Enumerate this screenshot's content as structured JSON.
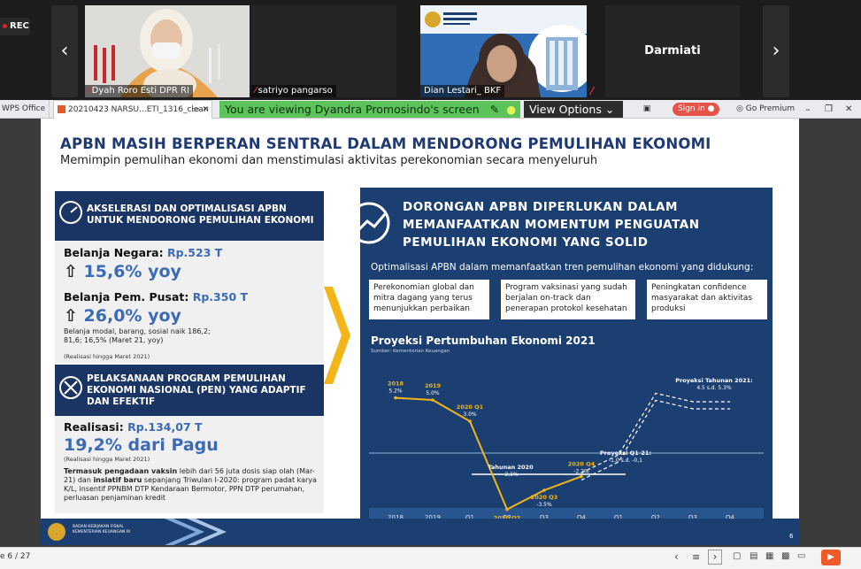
{
  "meeting": {
    "rec_label": "REC",
    "participants": [
      {
        "name": "Dyah Roro Esti DPR RI"
      },
      {
        "name": "satriyo pangarso"
      },
      {
        "name": "Dian Lestari_ BKF"
      },
      {
        "name": "Darmiati"
      }
    ],
    "share_banner": "You are viewing Dyandra Promosindo's screen",
    "view_options": "View Options",
    "icons": [
      "chevron-left-icon",
      "chevron-right-icon",
      "mic-muted-icon",
      "chevron-down-icon"
    ]
  },
  "toolbar": {
    "app": "WPS Office",
    "doc_tab": "20210423 NARSU...ETI_1316_clean",
    "sign_in": "Sign in",
    "go_premium": "Go Premium",
    "icons": [
      "minimize-icon",
      "restore-icon",
      "close-icon",
      "share-icon",
      "close-tab-icon",
      "avatar-icon"
    ]
  },
  "slide": {
    "title": "APBN MASIH BERPERAN SENTRAL DALAM MENDORONG PEMULIHAN EKONOMI",
    "subtitle": "Memimpin pemulihan ekonomi dan menstimulasi aktivitas perekonomian secara menyeluruh",
    "left": {
      "box1_head": "AKSELERASI DAN OPTIMALISASI APBN UNTUK MENDORONG PEMULIHAN EKONOMI",
      "belanja_negara_label": "Belanja Negara:",
      "belanja_negara_value": "Rp.523 T",
      "belanja_negara_growth": "15,6% yoy",
      "belanja_pusat_label": "Belanja Pem. Pusat:",
      "belanja_pusat_value": "Rp.350 T",
      "belanja_pusat_growth": "26,0% yoy",
      "belanja_note": "Belanja modal, barang, sosial naik 186,2; 81,6; 16,5% (Maret 21, yoy)",
      "realisasi_note1": "(Realisasi hingga Maret 2021)",
      "box2_head": "PELAKSANAAN PROGRAM PEMULIHAN EKONOMI NASIONAL (PEN) YANG ADAPTIF DAN EFEKTIF",
      "realisasi_label": "Realisasi:",
      "realisasi_value": "Rp.134,07 T",
      "realisasi_pct": "19,2% dari Pagu",
      "realisasi_note2": "(Realisasi hingga Maret 2021)",
      "vaksin_bold1": "Termasuk pengadaan vaksin",
      "vaksin_text1": " lebih dari 56 juta dosis siap olah (Mar-21) dan ",
      "vaksin_bold2": "insiatif baru",
      "vaksin_text2": " sepanjang Triwulan I-2020: program padat karya K/L, insentif PPNBM DTP Kendaraan Bermotor, PPN DTP perumahan, perluasan penjaminan kredit"
    },
    "right": {
      "title": "DORONGAN APBN DIPERLUKAN DALAM MEMANFAATKAN MOMENTUM PENGUATAN PEMULIHAN EKONOMI YANG SOLID",
      "sub": "Optimalisasi APBN dalam memanfaatkan tren pemulihan ekonomi yang didukung:",
      "cards": [
        "Perekonomian global dan mitra dagang yang terus menunjukkan perbaikan",
        "Program vaksinasi yang sudah berjalan on-track dan penerapan protokol kesehatan",
        "Peningkatan confidence masyarakat dan aktivitas produksi"
      ],
      "chart_title": "Proyeksi Pertumbuhan Ekonomi 2021",
      "chart_source": "Sumber: Kementerian Keuangan"
    },
    "footer_org": "BADAN KEBIJAKAN FISKAL KEMENTERIAN KEUANGAN RI",
    "page_number": "6"
  },
  "chart_data": {
    "type": "line",
    "title": "Proyeksi Pertumbuhan Ekonomi 2021",
    "categories": [
      "2018",
      "2019",
      "Q1",
      "Q2",
      "Q3",
      "Q4",
      "Q1",
      "Q2",
      "Q3",
      "Q4"
    ],
    "group_labels": [
      "2020",
      "2021F"
    ],
    "series": [
      {
        "values": [
          5.2,
          5.0,
          3.0,
          -5.3,
          -3.5,
          -2.2,
          null,
          null,
          null,
          null
        ]
      },
      {
        "values": [
          null,
          null,
          null,
          null,
          null,
          -2.2,
          -0.5,
          5.3,
          4.5,
          4.5
        ]
      }
    ],
    "annotations": [
      {
        "label": "2018",
        "value": "5.2%"
      },
      {
        "label": "2019",
        "value": "5.0%"
      },
      {
        "label": "2020 Q1",
        "value": "3.0%"
      },
      {
        "label": "2020 Q2",
        "value": "-5.3%"
      },
      {
        "label": "2020 Q3",
        "value": "-3.5%"
      },
      {
        "label": "2020 Q4",
        "value": "-2.2%"
      },
      {
        "label": "Tahunan 2020",
        "value": "-2,1%"
      },
      {
        "label": "Proyeksi Q1-21:",
        "value": "-1,0 s.d. -0,1"
      },
      {
        "label": "Proyeksi Tahunan 2021:",
        "value": "4.5 s.d. 5.3%"
      }
    ]
  },
  "status": {
    "page": "e 6 / 27"
  }
}
